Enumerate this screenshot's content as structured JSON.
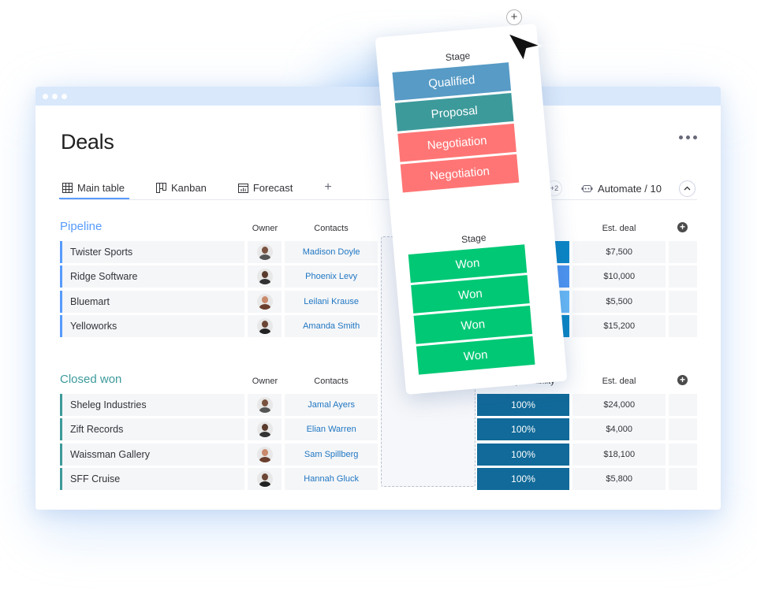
{
  "window": {
    "title": "Deals",
    "more_icon": "more-horizontal-icon"
  },
  "tabs": [
    {
      "label": "Main table",
      "icon": "table-icon",
      "active": true
    },
    {
      "label": "Kanban",
      "icon": "kanban-icon",
      "active": false
    },
    {
      "label": "Forecast",
      "icon": "chart-icon",
      "active": false
    }
  ],
  "tabs_add": "+",
  "toolbar": {
    "members_extra": "+2",
    "automate_label": "Automate / 10",
    "automate_icon": "robot-icon",
    "collapse_icon": "chevron-up-icon"
  },
  "columns": {
    "owner": "Owner",
    "contacts": "Contacts",
    "close_probability": "Close probability",
    "est_deal": "Est. deal"
  },
  "groups": {
    "pipeline": {
      "title": "Pipeline",
      "color": "#579bfc",
      "rows": [
        {
          "name": "Twister Sports",
          "contact": "Madison Doyle",
          "probability_color": "#0a86c6",
          "est_deal": "$7,500"
        },
        {
          "name": "Ridge Software",
          "contact": "Phoenix Levy",
          "probability_color": "#4e95f2",
          "est_deal": "$10,000"
        },
        {
          "name": "Bluemart",
          "contact": "Leilani Krause",
          "probability_color": "#68b9f8",
          "est_deal": "$5,500"
        },
        {
          "name": "Yelloworks",
          "contact": "Amanda Smith",
          "probability_color": "#0a86c6",
          "est_deal": "$15,200"
        }
      ]
    },
    "closed_won": {
      "title": "Closed won",
      "color": "#3d9a9b",
      "rows": [
        {
          "name": "Sheleg Industries",
          "contact": "Jamal Ayers",
          "probability": "100%",
          "est_deal": "$24,000"
        },
        {
          "name": "Zift Records",
          "contact": "Elian Warren",
          "probability": "100%",
          "est_deal": "$4,000"
        },
        {
          "name": "Waissman Gallery",
          "contact": "Sam Spillberg",
          "probability": "100%",
          "est_deal": "$18,100"
        },
        {
          "name": "SFF Cruise",
          "contact": "Hannah Gluck",
          "probability": "100%",
          "est_deal": "$5,800"
        }
      ]
    }
  },
  "floating_card": {
    "top_header": "Stage",
    "top_stages": [
      {
        "label": "Qualified",
        "color": "#579bc6"
      },
      {
        "label": "Proposal",
        "color": "#3d9a9b"
      },
      {
        "label": "Negotiation",
        "color": "#ff7575"
      },
      {
        "label": "Negotiation",
        "color": "#ff7575"
      }
    ],
    "bottom_header": "Stage",
    "bottom_stages": [
      {
        "label": "Won",
        "color": "#00c875"
      },
      {
        "label": "Won",
        "color": "#00c875"
      },
      {
        "label": "Won",
        "color": "#00c875"
      },
      {
        "label": "Won",
        "color": "#00c875"
      }
    ],
    "add_icon": "plus-icon",
    "add_label": "+"
  },
  "colors": {
    "probability_closed": "#116a99",
    "accent": "#579bfc",
    "contact_link": "#1f76c2"
  }
}
